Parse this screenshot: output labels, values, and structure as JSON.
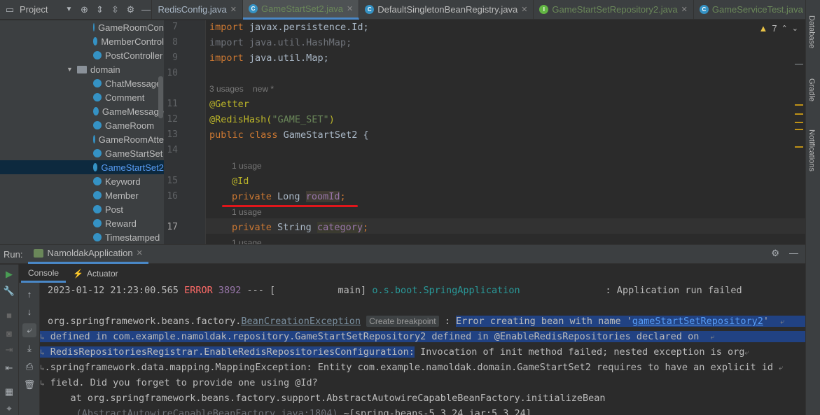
{
  "project_header": {
    "label": "Project"
  },
  "editor_tabs": [
    {
      "label": "RedisConfig.java",
      "type": "plain"
    },
    {
      "label": "GameStartSet2.java",
      "type": "class",
      "active": true
    },
    {
      "label": "DefaultSingletonBeanRegistry.java",
      "type": "class"
    },
    {
      "label": "GameStartSetRepository2.java",
      "type": "interface"
    },
    {
      "label": "GameServiceTest.java",
      "type": "class"
    }
  ],
  "tree": {
    "items": [
      {
        "label": "GameRoomCon",
        "kind": "class"
      },
      {
        "label": "MemberControl",
        "kind": "class"
      },
      {
        "label": "PostController",
        "kind": "class"
      },
      {
        "label": "domain",
        "kind": "folder"
      },
      {
        "label": "ChatMessage",
        "kind": "class"
      },
      {
        "label": "Comment",
        "kind": "class"
      },
      {
        "label": "GameMessage",
        "kind": "class"
      },
      {
        "label": "GameRoom",
        "kind": "class"
      },
      {
        "label": "GameRoomAtte",
        "kind": "class"
      },
      {
        "label": "GameStartSet",
        "kind": "class"
      },
      {
        "label": "GameStartSet2",
        "kind": "class",
        "selected": true
      },
      {
        "label": "Keyword",
        "kind": "class"
      },
      {
        "label": "Member",
        "kind": "class"
      },
      {
        "label": "Post",
        "kind": "class"
      },
      {
        "label": "Reward",
        "kind": "class"
      },
      {
        "label": "Timestamped",
        "kind": "class"
      }
    ]
  },
  "editor": {
    "warnings_count": "7",
    "line_numbers": [
      "7",
      "8",
      "9",
      "10",
      "11",
      "12",
      "13",
      "14",
      "15",
      "16",
      "17"
    ],
    "code": {
      "l7_kw": "import",
      "l7_rest": " javax.persistence.Id;",
      "l8": "import java.util.HashMap;",
      "l9_kw": "import",
      "l9_rest": " java.util.Map;",
      "usages_class": "3 usages",
      "new_marker": "new *",
      "l11": "@Getter",
      "l12_ann": "@RedisHash(",
      "l12_str": "\"GAME_SET\"",
      "l12_end": ")",
      "l13_kw": "public class",
      "l13_rest": " GameStartSet2 {",
      "usage_1": "1 usage",
      "l15": "@Id",
      "l16_kw": "private",
      "l16_type": " Long ",
      "l16_field": "roomId",
      "l16_end": ";",
      "usage_2": "1 usage",
      "l17_kw": "private",
      "l17_type": " String ",
      "l17_field": "category",
      "l17_end": ";",
      "usage_3": "1 usage"
    }
  },
  "right_sidebar": {
    "tabs": [
      "Database",
      "Gradle",
      "Notifications"
    ]
  },
  "run_panel": {
    "label": "Run:",
    "config_name": "NamoldakApplication",
    "subtabs": [
      "Console",
      "Actuator"
    ]
  },
  "console": {
    "line1": {
      "timestamp": "2023-01-12 21:23:00.565",
      "level": "ERROR",
      "pid": "3892",
      "sep": " --- [           main] ",
      "logger": "o.s.boot.SpringApplication",
      "msg": "               : Application run failed"
    },
    "line2": {
      "prefix": "org.springframework.beans.factory.",
      "exception": "BeanCreationException",
      "breakpoint": "Create breakpoint",
      "colon": " : ",
      "sel_text": "Error creating bean with name '",
      "bean_link": "gameStartSetRepository2",
      "sel_end": "' "
    },
    "line3": "defined in com.example.namoldak.repository.GameStartSetRepository2 defined in @EnableRedisRepositories declared on ",
    "line4_sel": "RedisRepositoriesRegistrar.EnableRedisRepositoriesConfiguration:",
    "line4_rest": " Invocation of init method failed; nested exception is org",
    "line5": ".springframework.data.mapping.MappingException: Entity com.example.namoldak.domain.GameStartSet2 requires to have an explicit id ",
    "line6": "field. Did you forget to provide one using @Id?",
    "line7": "    at org.springframework.beans.factory.support.AbstractAutowireCapableBeanFactory.initializeBean",
    "line8_dim": "     (AbstractAutowireCapableBeanFactory.java:1804)",
    "line8_rest": " ~[spring-beans-5.3.24.jar:5.3.24]"
  }
}
